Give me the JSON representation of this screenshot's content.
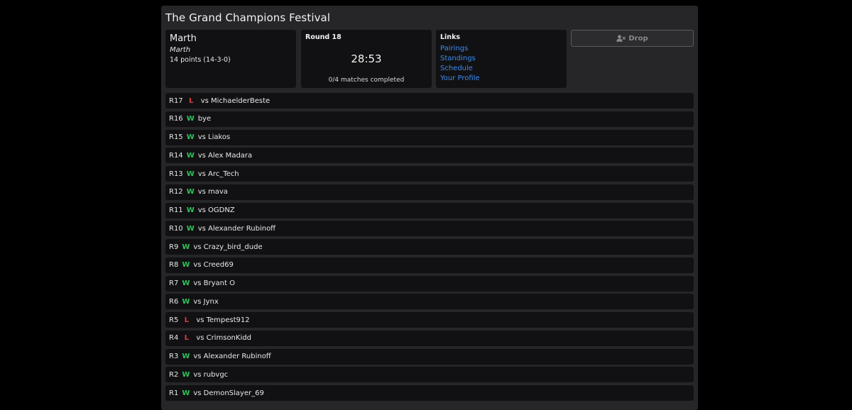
{
  "tournament": {
    "title": "The Grand Champions Festival"
  },
  "player": {
    "name": "Marth",
    "alias": "Marth",
    "points": "14 points (14-3-0)"
  },
  "round": {
    "title": "Round 18",
    "timer": "28:53",
    "status": "0/4 matches completed"
  },
  "links": {
    "title": "Links",
    "items": [
      "Pairings",
      "Standings",
      "Schedule",
      "Your Profile"
    ]
  },
  "drop": {
    "label": "Drop",
    "icon": "user-remove-icon"
  },
  "colors": {
    "win": "#2ec35a",
    "loss": "#e03a3a",
    "link": "#3d8cf0"
  },
  "matches": [
    {
      "round": "R17",
      "result": "L",
      "opponent": "vs MichaelderBeste"
    },
    {
      "round": "R16",
      "result": "W",
      "opponent": "bye"
    },
    {
      "round": "R15",
      "result": "W",
      "opponent": "vs Liakos"
    },
    {
      "round": "R14",
      "result": "W",
      "opponent": "vs Alex Madara"
    },
    {
      "round": "R13",
      "result": "W",
      "opponent": "vs Arc_Tech"
    },
    {
      "round": "R12",
      "result": "W",
      "opponent": "vs mava"
    },
    {
      "round": "R11",
      "result": "W",
      "opponent": "vs OGDNZ"
    },
    {
      "round": "R10",
      "result": "W",
      "opponent": "vs Alexander Rubinoff"
    },
    {
      "round": "R9",
      "result": "W",
      "opponent": "vs Crazy_bird_dude"
    },
    {
      "round": "R8",
      "result": "W",
      "opponent": "vs Creed69"
    },
    {
      "round": "R7",
      "result": "W",
      "opponent": "vs Bryant O"
    },
    {
      "round": "R6",
      "result": "W",
      "opponent": "vs Jynx"
    },
    {
      "round": "R5",
      "result": "L",
      "opponent": "vs Tempest912"
    },
    {
      "round": "R4",
      "result": "L",
      "opponent": "vs CrimsonKidd"
    },
    {
      "round": "R3",
      "result": "W",
      "opponent": "vs Alexander Rubinoff"
    },
    {
      "round": "R2",
      "result": "W",
      "opponent": "vs rubvgc"
    },
    {
      "round": "R1",
      "result": "W",
      "opponent": "vs DemonSlayer_69"
    }
  ]
}
